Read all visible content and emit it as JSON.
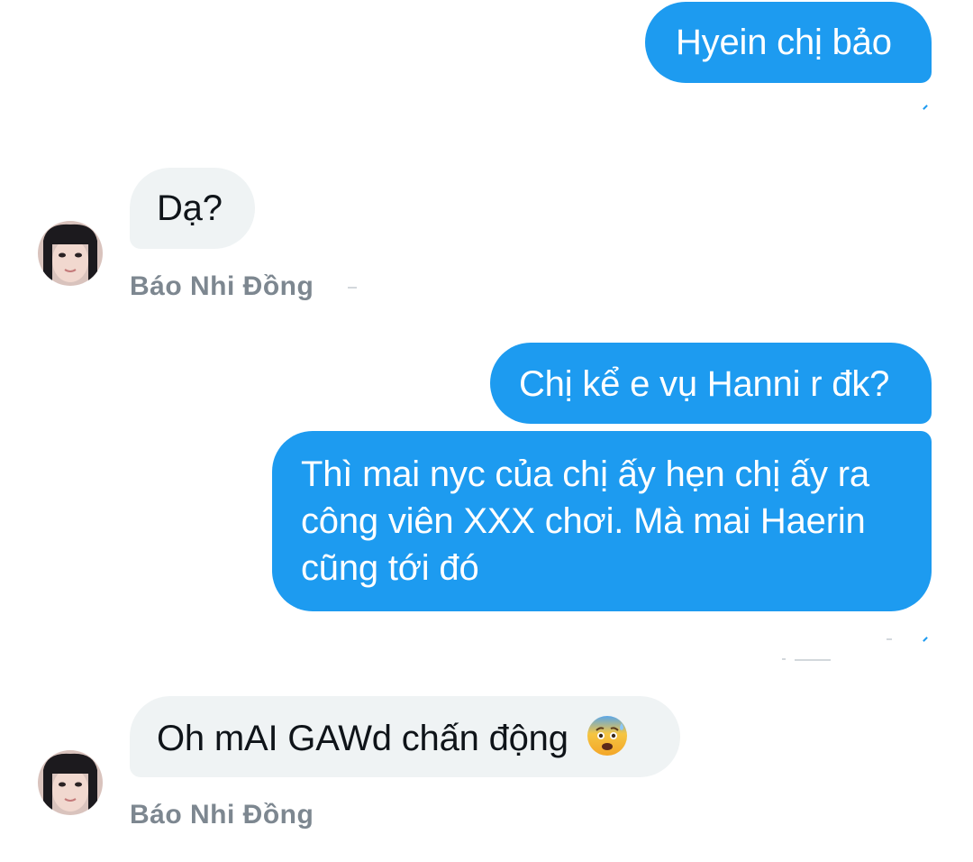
{
  "conversation": {
    "messages": [
      {
        "direction": "outgoing",
        "text": "Hyein chị bảo"
      },
      {
        "direction": "incoming",
        "text": "Dạ?",
        "sender": "Báo Nhi Đồng"
      },
      {
        "direction": "outgoing",
        "text": "Chị kể e vụ Hanni r đk?"
      },
      {
        "direction": "outgoing",
        "text": "Thì mai nyc của chị ấy hẹn chị ấy ra công viên XXX chơi. Mà mai Haerin cũng tới đó"
      },
      {
        "direction": "incoming",
        "text": "Oh mAI GAWd chấn động",
        "emoji": "anxious-face-with-sweat-icon",
        "sender": "Báo Nhi Đồng"
      }
    ]
  },
  "colors": {
    "outgoing_bubble": "#1d9bf0",
    "incoming_bubble": "#eff3f4",
    "sender_text": "#7d8790"
  }
}
